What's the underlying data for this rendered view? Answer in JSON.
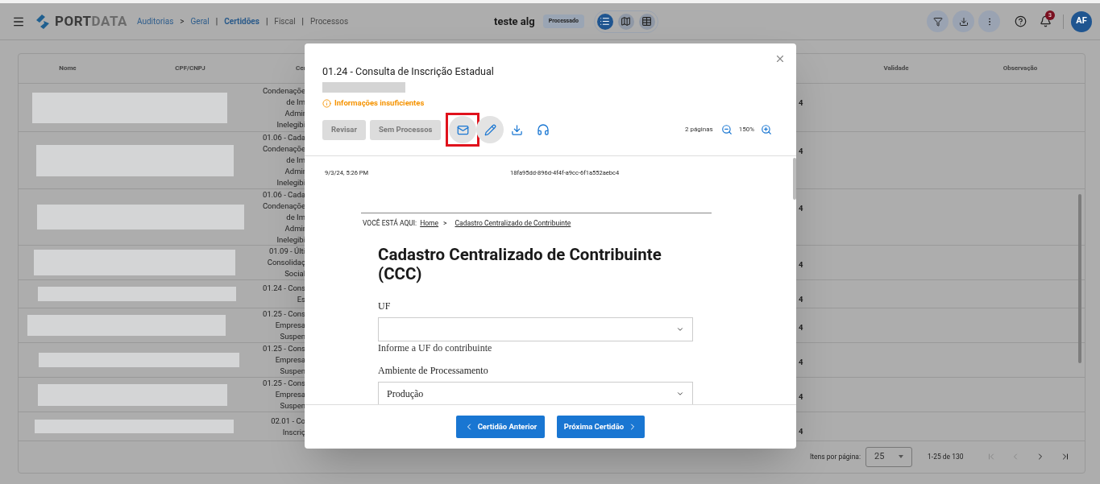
{
  "topbar": {
    "logo": {
      "part1": "PORT",
      "part2": "DATA"
    },
    "breadcrumb": [
      {
        "label": "Auditorias",
        "kind": "link"
      },
      {
        "label": ">",
        "kind": "separator"
      },
      {
        "label": "Geral",
        "kind": "link"
      },
      {
        "label": "|",
        "kind": "separator"
      },
      {
        "label": "Certidões",
        "kind": "current"
      },
      {
        "label": "|",
        "kind": "separator"
      },
      {
        "label": "Fiscal",
        "kind": "plain"
      },
      {
        "label": "|",
        "kind": "separator"
      },
      {
        "label": "Processos",
        "kind": "plain"
      }
    ],
    "title": "teste alg",
    "status_badge": "Processado",
    "view_modes": [
      {
        "kind": "list",
        "selected": true
      },
      {
        "kind": "map",
        "selected": false
      },
      {
        "kind": "table",
        "selected": false
      }
    ],
    "notifications_count": "3",
    "avatar": "AF"
  },
  "table": {
    "columns": [
      "Nome",
      "CPF/CNPJ",
      "Cer",
      "Validade",
      "Observação"
    ],
    "rows": [
      {
        "certidao": [
          "Condenaçõe",
          "de Im",
          "Admir",
          "Inelegibi"
        ],
        "column_4": "4"
      },
      {
        "certidao": [
          "01.06 - Cada",
          "Condenaçõe",
          "de Im",
          "Admir",
          "Inelegibi"
        ],
        "column_4": "4"
      },
      {
        "certidao": [
          "01.06 - Cada",
          "Condenaçõe",
          "de Im",
          "Admir",
          "Inelegibi"
        ],
        "column_4": "4"
      },
      {
        "certidao": [
          "01.09 - Últi",
          "Consolidaç",
          "Social"
        ],
        "column_4": "4"
      },
      {
        "certidao": [
          "01.24 - Cons",
          "Es"
        ],
        "column_4": "4"
      },
      {
        "certidao": [
          "01.25 - Cons",
          "Empresa",
          "Suspen"
        ],
        "column_4": "4"
      },
      {
        "certidao": [
          "01.25 - Cons",
          "Empresa",
          "Suspen"
        ],
        "column_4": "4"
      },
      {
        "certidao": [
          "01.25 - Cons",
          "Empresa",
          "Suspen"
        ],
        "column_4": "4"
      },
      {
        "certidao": [
          "02.01 - Co",
          "Inscriç"
        ],
        "column_4": "4"
      }
    ]
  },
  "pagination": {
    "label": "Itens por página:",
    "page_size": "25",
    "range": "1-25 de 130",
    "first_disabled": true,
    "prev_disabled": true,
    "next_disabled": false,
    "last_disabled": false
  },
  "modal": {
    "title": "01.24 - Consulta de Inscrição Estadual",
    "warning": "Informações insuficientes",
    "actions": [
      {
        "label": "Revisar",
        "disabled": true
      },
      {
        "label": "Sem Processos",
        "disabled": true
      }
    ],
    "tools": [
      {
        "kind": "mail",
        "filled": true,
        "highlighted": true
      },
      {
        "kind": "edit",
        "filled": true,
        "highlighted": false
      },
      {
        "kind": "download",
        "filled": false,
        "highlighted": false
      },
      {
        "kind": "headset",
        "filled": false,
        "highlighted": false
      }
    ],
    "pages": "2 páginas",
    "zoom": "150%",
    "document": {
      "timestamp": "9/3/24, 5:26 PM",
      "hash": "18fa95dd-896d-4f4f-a9cc-6f1a552aebc4",
      "breadcrumb_label": "VOCÊ ESTÁ AQUI:",
      "breadcrumb": [
        {
          "label": "Home",
          "kind": "link"
        },
        {
          "label": ">",
          "kind": "separator"
        },
        {
          "label": "Cadastro Centralizado de Contribuinte",
          "kind": "link"
        }
      ],
      "heading": "Cadastro Centralizado de Contribuinte (CCC)",
      "fields": [
        {
          "label": "UF",
          "help": "Informe a UF do contribuinte"
        },
        {
          "label": "Ambiente de Processamento",
          "value": "Produção"
        }
      ]
    },
    "prev_button": "Certidão Anterior",
    "next_button": "Próxima Certidão"
  }
}
